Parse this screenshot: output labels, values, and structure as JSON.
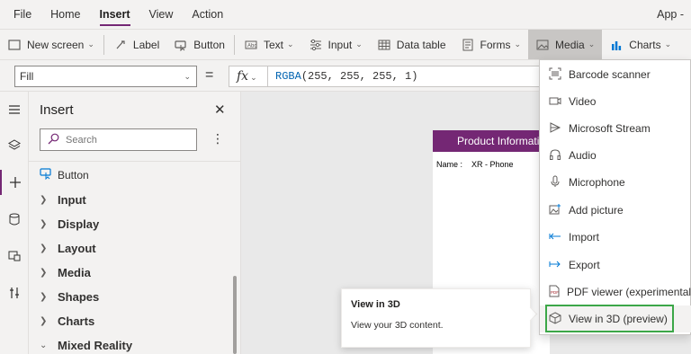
{
  "menubar": {
    "items": [
      "File",
      "Home",
      "Insert",
      "View",
      "Action"
    ],
    "active": "Insert",
    "app_label": "App -"
  },
  "toolbar": {
    "new_screen": "New screen",
    "label": "Label",
    "button": "Button",
    "text": "Text",
    "input": "Input",
    "data_table": "Data table",
    "forms": "Forms",
    "media": "Media",
    "charts": "Charts"
  },
  "formula": {
    "property": "Fill",
    "equals": "=",
    "fx": "fx",
    "fn_name": "RGBA",
    "args": "(255, 255, 255, 1)"
  },
  "panel": {
    "title": "Insert",
    "search_placeholder": "Search",
    "button_item": "Button",
    "categories": [
      "Input",
      "Display",
      "Layout",
      "Media",
      "Shapes",
      "Charts",
      "Mixed Reality"
    ]
  },
  "canvas": {
    "header": "Product Informati",
    "name_label": "Name :",
    "name_value": "XR - Phone"
  },
  "tooltip": {
    "title": "View in 3D",
    "description": "View your 3D content."
  },
  "media_menu": {
    "items": [
      {
        "label": "Barcode scanner",
        "icon": "barcode-icon"
      },
      {
        "label": "Video",
        "icon": "video-icon"
      },
      {
        "label": "Microsoft Stream",
        "icon": "stream-icon"
      },
      {
        "label": "Audio",
        "icon": "headphones-icon"
      },
      {
        "label": "Microphone",
        "icon": "microphone-icon"
      },
      {
        "label": "Add picture",
        "icon": "add-picture-icon"
      },
      {
        "label": "Import",
        "icon": "import-icon"
      },
      {
        "label": "Export",
        "icon": "export-icon"
      },
      {
        "label": "PDF viewer (experimental)",
        "icon": "pdf-icon"
      },
      {
        "label": "View in 3D (preview)",
        "icon": "cube-icon"
      }
    ]
  },
  "colors": {
    "accent": "#742774",
    "highlight_border": "#3ca748",
    "link_blue": "#0078d4"
  }
}
